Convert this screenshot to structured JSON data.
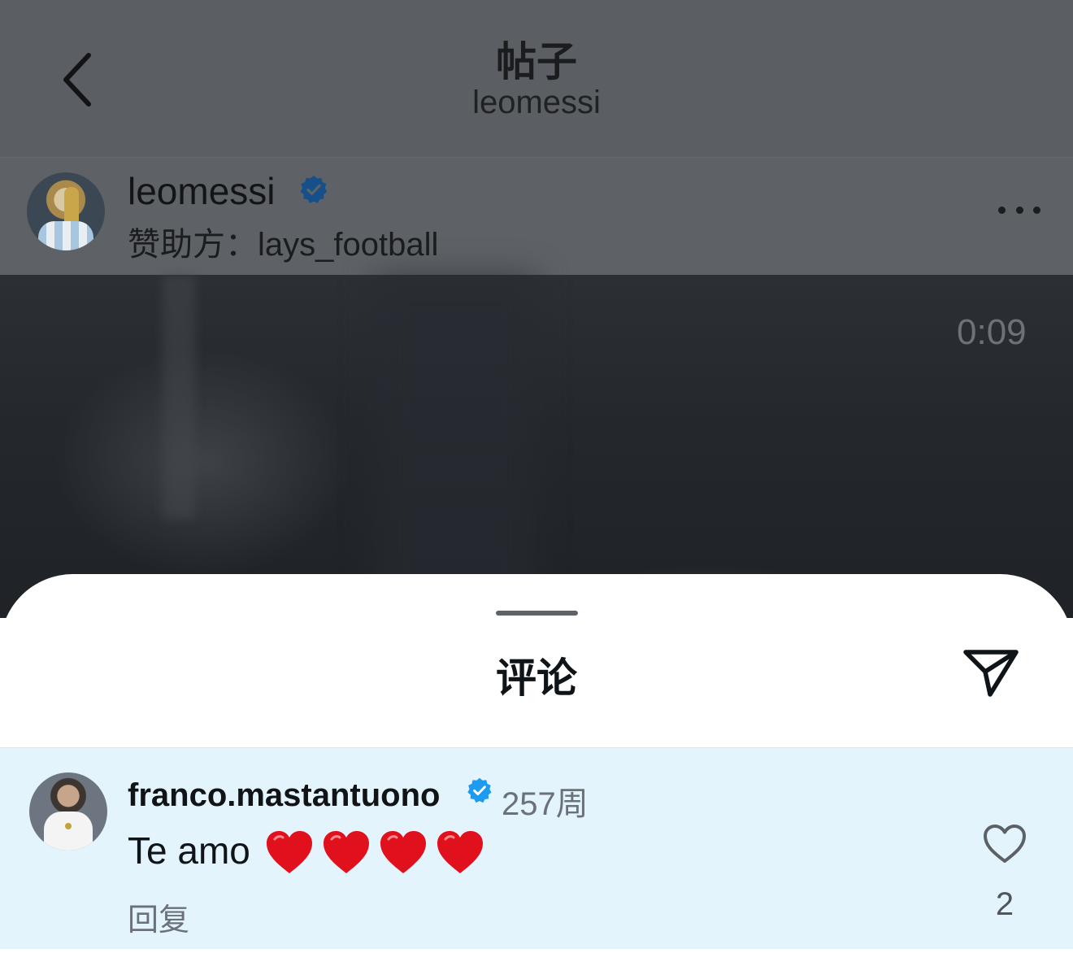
{
  "nav": {
    "title": "帖子",
    "subtitle": "leomessi"
  },
  "post": {
    "author": "leomessi",
    "verified": true,
    "sponsor_label": "赞助方：",
    "sponsor_name": "lays_football",
    "video_time": "0:09"
  },
  "comments_sheet": {
    "title": "评论",
    "comments": [
      {
        "username": "franco.mastantuono",
        "verified": true,
        "time": "257周",
        "text": "Te amo",
        "emoji_count": 4,
        "reply_label": "回复",
        "likes": "2"
      }
    ]
  },
  "colors": {
    "verified_blue": "#1d9bf0",
    "heart_red": "#e0101d",
    "highlight_row": "#e4f4fd"
  },
  "icons": [
    "back-chevron-icon",
    "verified-badge-icon",
    "more-dots-icon",
    "send-icon",
    "heart-outline-icon",
    "red-heart-emoji"
  ]
}
